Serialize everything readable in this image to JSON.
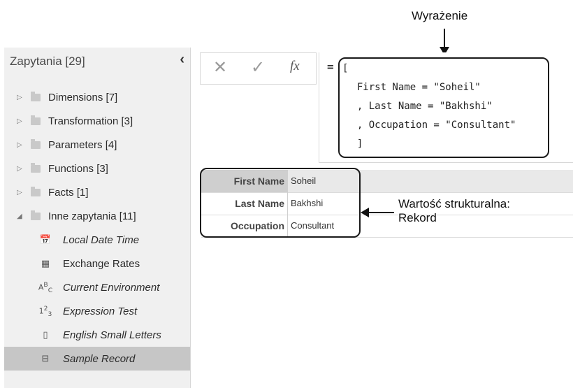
{
  "annotations": {
    "expression_label": "Wyrażenie",
    "structured_value_label_line1": "Wartość strukturalna:",
    "structured_value_label_line2": "Rekord"
  },
  "sidebar": {
    "title": "Zapytania [29]",
    "groups": [
      {
        "label": "Dimensions [7]",
        "expanded": false
      },
      {
        "label": "Transformation [3]",
        "expanded": false
      },
      {
        "label": "Parameters [4]",
        "expanded": false
      },
      {
        "label": "Functions [3]",
        "expanded": false
      },
      {
        "label": "Facts [1]",
        "expanded": false
      },
      {
        "label": "Inne zapytania [11]",
        "expanded": true
      }
    ],
    "queries": [
      {
        "label": "Local Date Time",
        "icon": "datetime-icon",
        "glyph": "📅",
        "italic": true
      },
      {
        "label": "Exchange Rates",
        "icon": "table-icon",
        "glyph": "▦",
        "italic": false
      },
      {
        "label": "Current Environment",
        "icon": "text-type-icon",
        "glyph": "ABC",
        "italic": true
      },
      {
        "label": "Expression Test",
        "icon": "number-type-icon",
        "glyph": "123",
        "italic": true
      },
      {
        "label": "English Small Letters",
        "icon": "list-icon",
        "glyph": "▯",
        "italic": true
      },
      {
        "label": "Sample Record",
        "icon": "record-icon",
        "glyph": "⊟",
        "italic": true,
        "selected": true
      }
    ]
  },
  "formula_bar": {
    "cancel_glyph": "✕",
    "commit_glyph": "✓",
    "fx_label": "fx",
    "equals": "=",
    "code_lines": [
      "[",
      "  First Name = \"Soheil\"",
      "  , Last Name = \"Bakhshi\"",
      "  , Occupation = \"Consultant\"",
      "  ]"
    ]
  },
  "record": {
    "rows": [
      {
        "field": "First Name",
        "value": "Soheil"
      },
      {
        "field": "Last Name",
        "value": "Bakhshi"
      },
      {
        "field": "Occupation",
        "value": "Consultant"
      }
    ]
  }
}
